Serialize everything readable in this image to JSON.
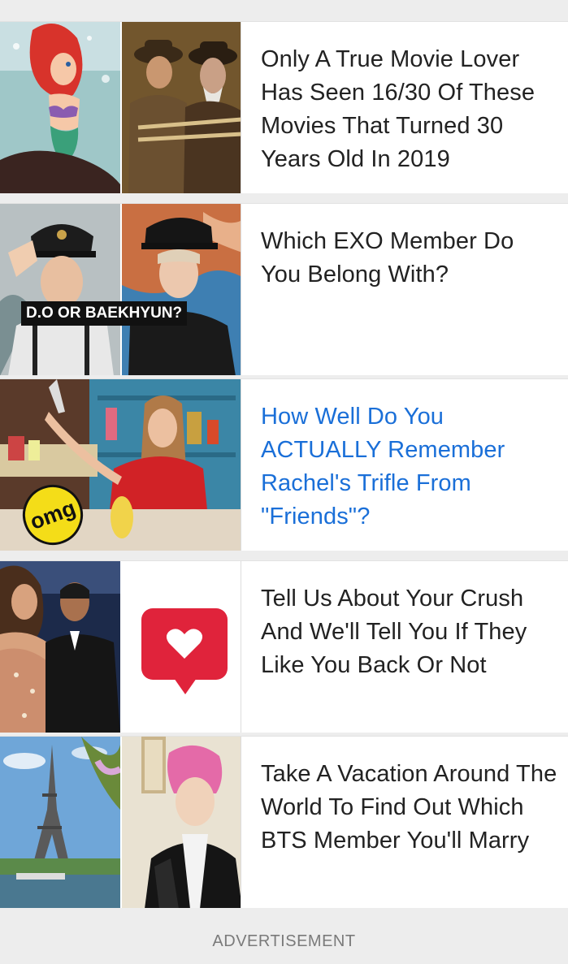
{
  "feed": {
    "items": [
      {
        "title": "Only A True Movie Lover Has Seen 16/30 Of These Movies That Turned 30 Years Old In 2019",
        "visited": false,
        "left_image": "little-mermaid-image",
        "right_image": "indiana-jones-image"
      },
      {
        "title": "Which EXO Member Do You Belong With?",
        "visited": false,
        "left_image": "do-exo-image",
        "right_image": "baekhyun-exo-image",
        "overlay": "D.O OR BAEKHYUN?"
      },
      {
        "title": "How Well Do You ACTUALLY Remember Rachel's Trifle From \"Friends\"?",
        "visited": true,
        "image": "rachel-trifle-image",
        "badge": "omg"
      },
      {
        "title": "Tell Us About Your Crush And We'll Tell You If They Like You Back Or Not",
        "visited": false,
        "left_image": "couple-image",
        "right_image": "heart-bubble-icon"
      },
      {
        "title": "Take A Vacation Around The World To Find Out Which BTS Member You'll Marry",
        "visited": false,
        "left_image": "eiffel-tower-image",
        "right_image": "bts-member-image"
      }
    ]
  },
  "ad": {
    "label": "ADVERTISEMENT"
  },
  "colors": {
    "visited_link": "#1a6fd8",
    "title_text": "#222222",
    "page_bg": "#ededed",
    "heart": "#e0233b",
    "omg_badge": "#f4dd18"
  }
}
